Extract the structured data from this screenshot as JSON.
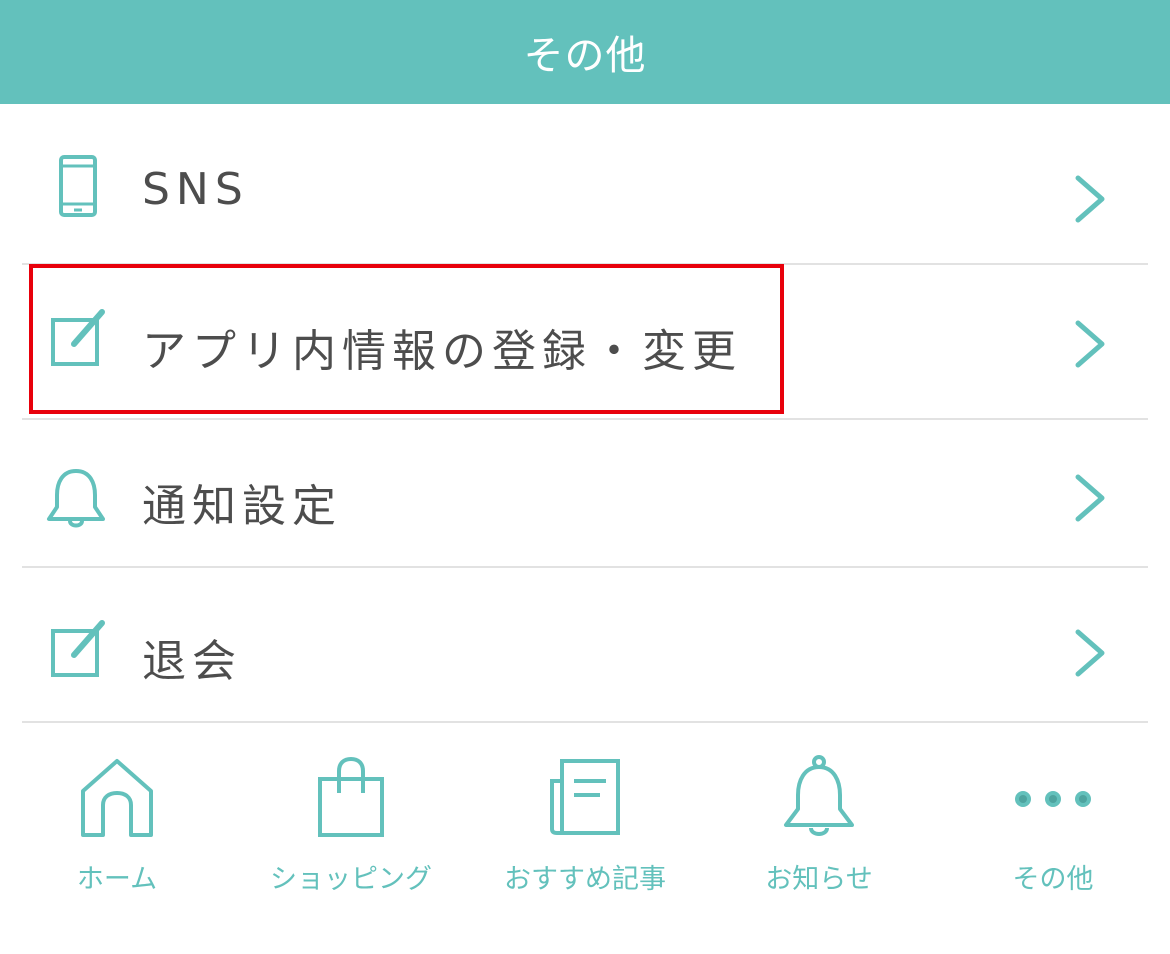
{
  "header": {
    "title": "その他"
  },
  "menu": {
    "items": [
      {
        "label": "SNS",
        "icon": "smartphone-icon"
      },
      {
        "label": "アプリ内情報の登録・変更",
        "icon": "edit-icon"
      },
      {
        "label": "通知設定",
        "icon": "bell-icon"
      },
      {
        "label": "退会",
        "icon": "edit-icon"
      }
    ]
  },
  "tabbar": {
    "tabs": [
      {
        "label": "ホーム",
        "icon": "home-icon"
      },
      {
        "label": "ショッピング",
        "icon": "shopping-bag-icon"
      },
      {
        "label": "おすすめ記事",
        "icon": "newspaper-icon"
      },
      {
        "label": "お知らせ",
        "icon": "bell-icon"
      },
      {
        "label": "その他",
        "icon": "more-dots-icon"
      }
    ]
  },
  "colors": {
    "accent": "#63c1bc",
    "highlight": "#e8000b",
    "text": "#4d4d4d",
    "divider": "#e2e2e2"
  }
}
